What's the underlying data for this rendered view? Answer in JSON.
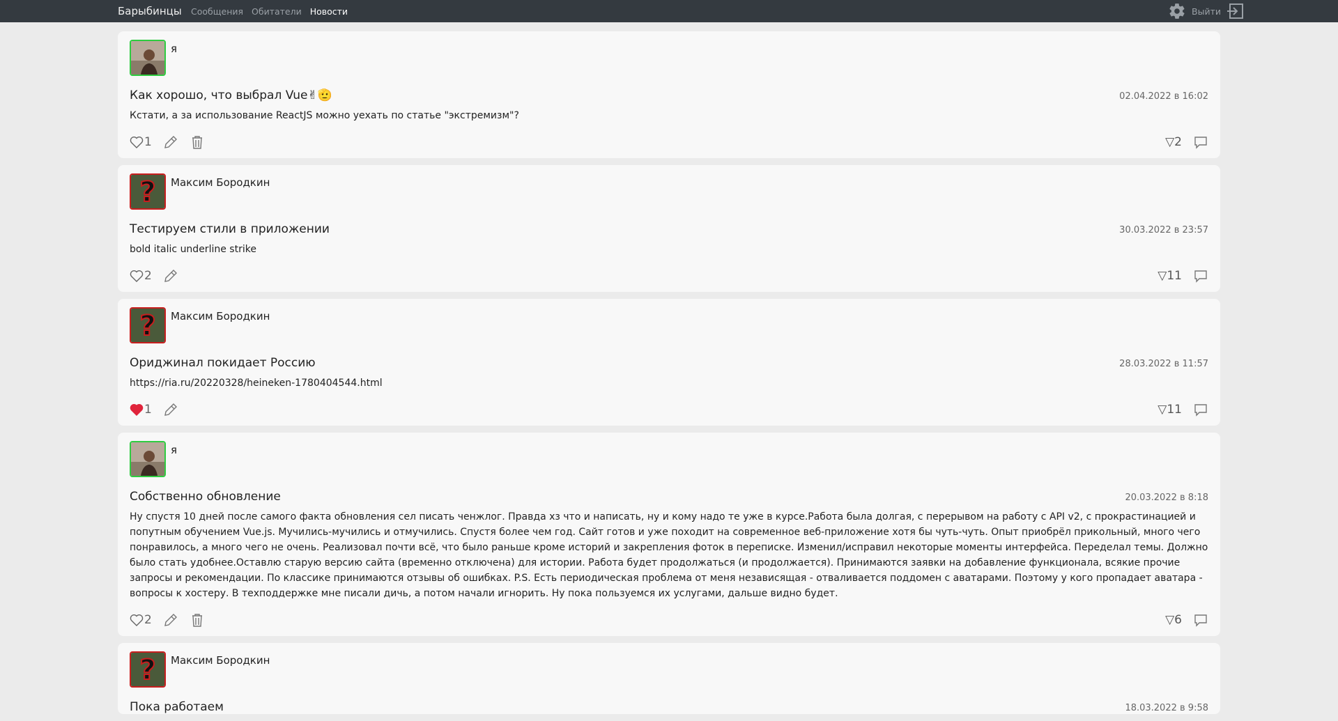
{
  "header": {
    "brand": "Барыбинцы",
    "nav": [
      "Сообщения",
      "Обитатели",
      "Новости"
    ],
    "active_nav": "Новости",
    "logout_label": "Выйти"
  },
  "posts": [
    {
      "author": "я",
      "avatar": "green",
      "title": "Как хорошо, что выбрал Vue✌🫡",
      "date": "02.04.2022 в 16:02",
      "body": "Кстати, а за использование ReactJS можно уехать по статье \"экстремизм\"?",
      "likes": "1",
      "liked": false,
      "can_delete": true,
      "views": "▽2"
    },
    {
      "author": "Максим Бородкин",
      "avatar": "red",
      "title": "Тестируем стили в приложении",
      "date": "30.03.2022 в 23:57",
      "body": "bold italic underline strike",
      "likes": "2",
      "liked": false,
      "can_delete": false,
      "views": "▽11"
    },
    {
      "author": "Максим Бородкин",
      "avatar": "red",
      "title": "Ориджинал покидает Россию",
      "date": "28.03.2022 в 11:57",
      "body": "https://ria.ru/20220328/heineken-1780404544.html",
      "likes": "1",
      "liked": true,
      "can_delete": false,
      "views": "▽11"
    },
    {
      "author": "я",
      "avatar": "green",
      "title": "Собственно обновление",
      "date": "20.03.2022 в 8:18",
      "body": "Ну спустя 10 дней после самого факта обновления сел писать ченжлог. Правда хз что и написать, ну и кому надо те уже в курсе.Работа была долгая, с перерывом на работу с API v2, с прокрастинацией и попутным обучением Vue.js. Мучились-мучились и отмучились. Спустя более чем год. Сайт готов и уже походит на современное веб-приложение хотя бы чуть-чуть. Опыт приобрёл прикольный, много чего понравилось, а много чего не очень. Реализовал почти всё, что было раньше кроме историй и закрепления фоток в переписке. Изменил/исправил некоторые моменты интерфейса. Переделал темы. Должно было стать удобнее.Оставлю старую версию сайта (временно отключена) для истории. Работа будет продолжаться (и продолжается). Принимаются заявки на добавление функционала, всякие прочие запросы и рекомендации. По классике принимаются отзывы об ошибках. P.S. Есть периодическая проблема от меня независящая - отваливается поддомен с аватарами. Поэтому у кого пропадает аватара - вопросы к хостеру. В техподдержке мне писали дичь, а потом начали игнорить. Ну пока пользуемся их услугами, дальше видно будет.",
      "likes": "2",
      "liked": false,
      "can_delete": true,
      "views": "▽6"
    },
    {
      "author": "Максим Бородкин",
      "avatar": "red",
      "title": "Пока работаем",
      "date": "18.03.2022 в 9:58"
    }
  ]
}
